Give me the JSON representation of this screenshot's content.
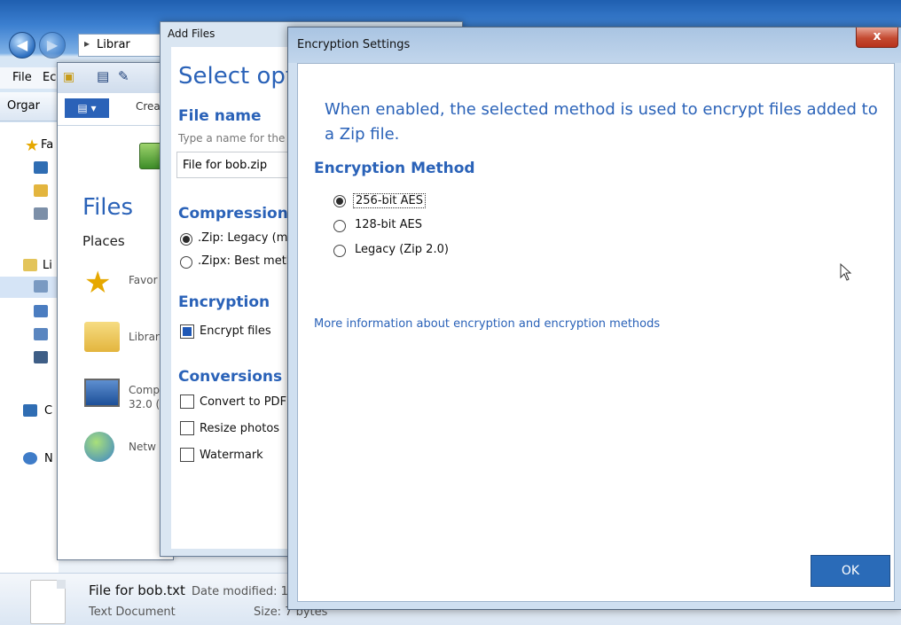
{
  "explorer": {
    "breadcrumb": "Librar",
    "menu": [
      "File",
      "Ec"
    ],
    "toolbar_organize": "Orgar",
    "nav_labels": [
      "Fa",
      "Li",
      "C",
      "N"
    ],
    "status": {
      "filename": "File for bob.txt",
      "date_label": "Date modified: 1",
      "type": "Text Document",
      "size": "Size: 7 bytes"
    }
  },
  "winzip": {
    "ribbon_tab": "Crea",
    "files_title": "Files",
    "places_title": "Places",
    "places": [
      "Favor",
      "Librar",
      "Comp",
      "32.0 (",
      "Netw"
    ]
  },
  "add_files": {
    "title": "Add Files",
    "heading": "Select optic",
    "file_name_heading": "File name",
    "file_name_hint": "Type a name for the",
    "file_name_value": "File for bob.zip",
    "compression_heading": "Compression",
    "compression_options": [
      {
        "label": ".Zip: Legacy (ma",
        "selected": true
      },
      {
        "label": ".Zipx: Best meth",
        "selected": false
      }
    ],
    "encryption_heading": "Encryption",
    "encrypt_files_label": "Encrypt files",
    "encrypt_files_checked": true,
    "conversions_heading": "Conversions",
    "conversions": [
      {
        "label": "Convert to PDF",
        "checked": false
      },
      {
        "label": "Resize photos",
        "checked": false
      },
      {
        "label": "Watermark",
        "checked": false
      }
    ]
  },
  "encryption_settings": {
    "title": "Encryption Settings",
    "close_label": "x",
    "description": "When enabled, the selected method is used to encrypt files added to a Zip file.",
    "method_heading": "Encryption Method",
    "methods": [
      {
        "label": "256-bit AES",
        "selected": true
      },
      {
        "label": "128-bit AES",
        "selected": false
      },
      {
        "label": "Legacy (Zip 2.0)",
        "selected": false
      }
    ],
    "info_link": "More information about encryption and encryption methods",
    "ok_label": "OK"
  },
  "colors": {
    "accent": "#2a62b8",
    "ok_button": "#2a6bb8",
    "close_button": "#c44a31"
  }
}
